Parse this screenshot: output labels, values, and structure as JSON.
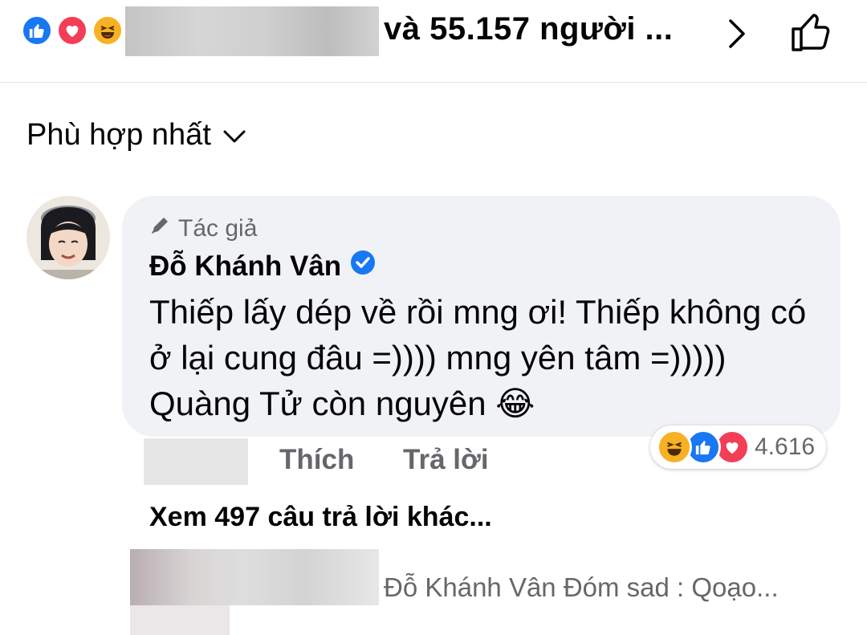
{
  "reactions_bar": {
    "icons": [
      "like-reaction",
      "love-reaction",
      "haha-reaction"
    ],
    "summary_text": "và 55.157 người ..."
  },
  "sort": {
    "label": "Phù hợp nhất"
  },
  "comment": {
    "author_badge": "Tác giả",
    "author_name": "Đỗ Khánh Vân",
    "text": "Thiếp lấy dép về rồi mng ơi! Thiếp không có ở lại cung đâu =)))) mng yên tâm =)))))  Quàng Tử còn nguyên 😂",
    "reaction_count": "4.616",
    "reaction_icons": [
      "haha-reaction",
      "like-reaction",
      "love-reaction"
    ],
    "actions": {
      "like": "Thích",
      "reply": "Trả lời"
    }
  },
  "replies": {
    "more_label": "Xem 497 câu trả lời khác...",
    "preview": "Đỗ Khánh Vân  Đóm sad : Qoạo..."
  },
  "colors": {
    "like_blue": "#1877f2",
    "love_red": "#f33e58",
    "haha_yellow": "#f7b125",
    "bubble_bg": "#f0f2f5",
    "secondary_text": "#65676b",
    "verified_blue": "#1877f2"
  }
}
